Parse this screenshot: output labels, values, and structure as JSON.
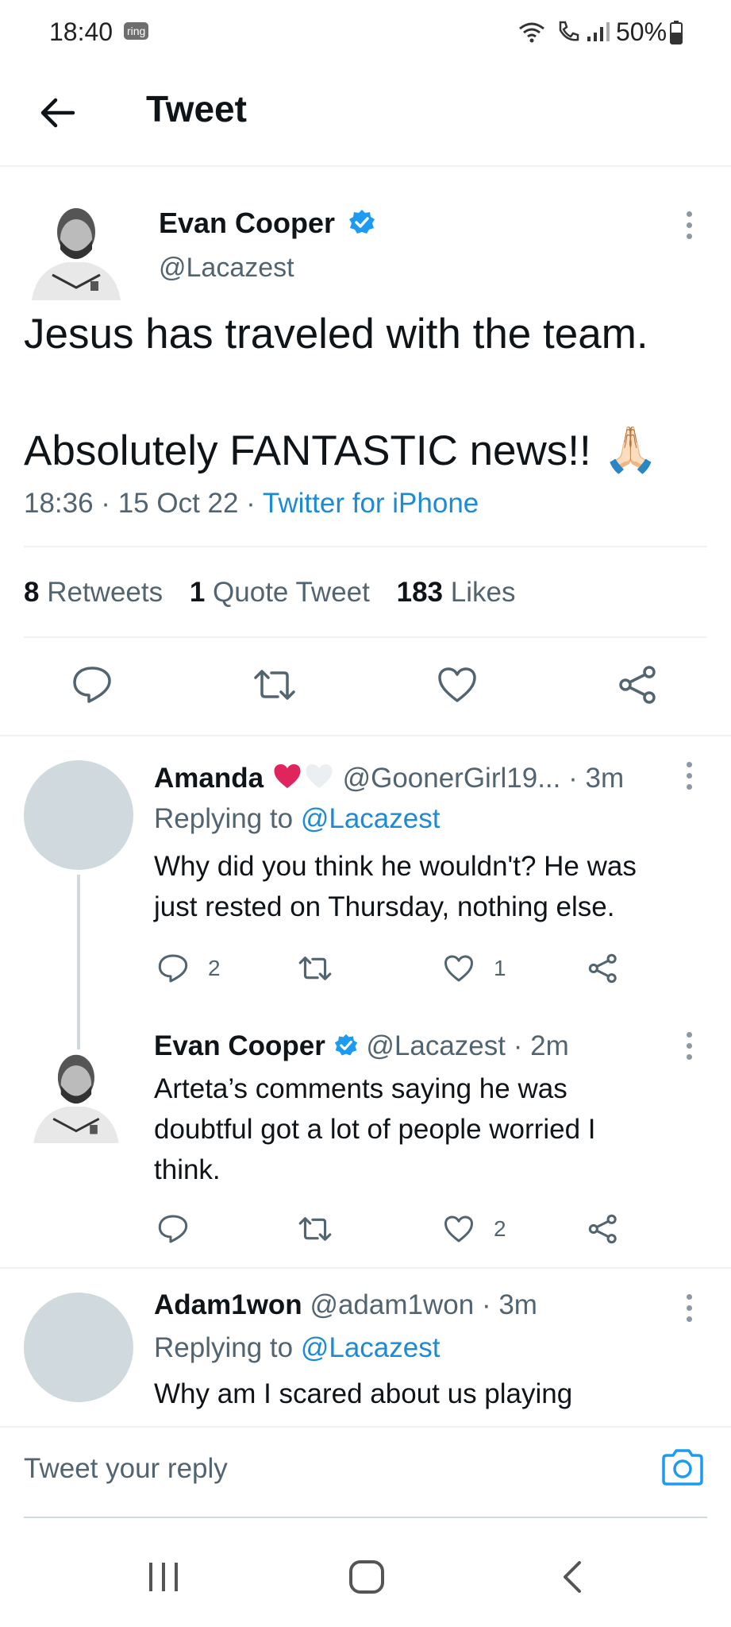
{
  "status_bar": {
    "time": "18:40",
    "carrier_badge": "ring",
    "battery": "50%"
  },
  "header": {
    "title": "Tweet"
  },
  "main_tweet": {
    "author_name": "Evan Cooper",
    "author_handle": "@Lacazest",
    "text_line1": "Jesus has traveled with the team.",
    "text_line2": "Absolutely FANTASTIC news!!",
    "emoji": "🙏🏻",
    "timestamp": "18:36 · 15 Oct 22 · ",
    "source": "Twitter for iPhone",
    "stats": {
      "retweets_count": "8",
      "retweets_label": "Retweets",
      "quotes_count": "1",
      "quotes_label": "Quote Tweet",
      "likes_count": "183",
      "likes_label": "Likes"
    }
  },
  "replies": [
    {
      "name": "Amanda",
      "handle": "@GoonerGirl19...",
      "time": "· 3m",
      "replying_prefix": "Replying to ",
      "replying_to": "@Lacazest",
      "text_line1": "Why did you think he wouldn't? He was",
      "text_line2": "just rested on Thursday, nothing else.",
      "reply_count": "2",
      "like_count": "1"
    },
    {
      "name": "Evan Cooper",
      "handle": "@Lacazest",
      "time": "· 2m",
      "text_line1": "Arteta’s comments saying he was",
      "text_line2": "doubtful got a lot of people worried I",
      "text_line3": "think.",
      "like_count": "2"
    },
    {
      "name": "Adam1won",
      "handle": "@adam1won",
      "time": "· 3m",
      "replying_prefix": "Replying to ",
      "replying_to": "@Lacazest",
      "text_line1": "Why am I scared about us playing"
    }
  ],
  "reply_bar": {
    "placeholder": "Tweet your reply"
  },
  "colors": {
    "accent": "#1d9bf0",
    "like_red": "#e0245e",
    "muted": "#536471"
  }
}
